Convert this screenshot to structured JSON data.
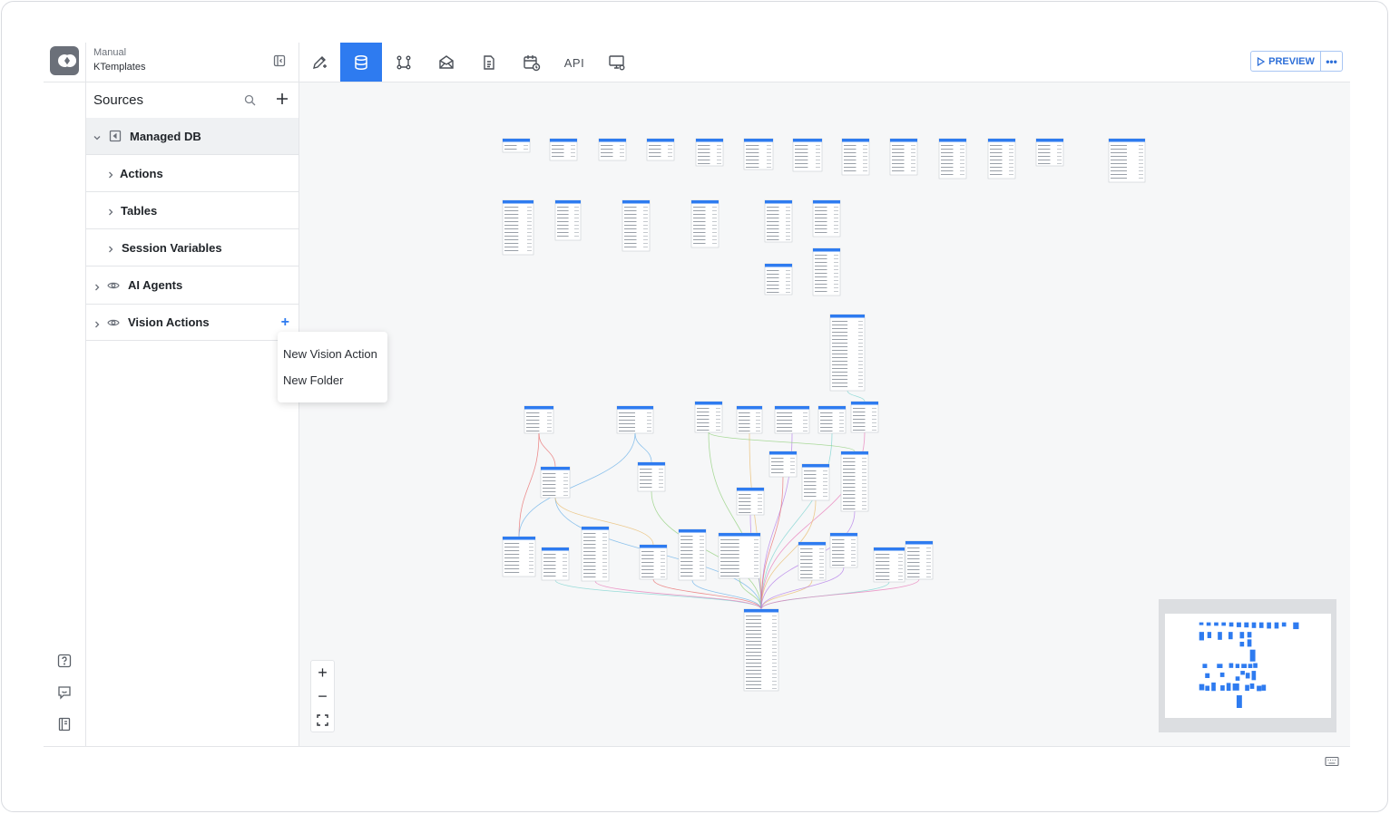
{
  "app": {
    "type_label": "Manual",
    "name": "KTemplates"
  },
  "toolbar": {
    "tabs": [
      {
        "icon": "pencil-plus-icon",
        "active": false
      },
      {
        "icon": "database-icon",
        "active": true
      },
      {
        "icon": "workflow-icon",
        "active": false
      },
      {
        "icon": "mail-icon",
        "active": false
      },
      {
        "icon": "document-icon",
        "active": false
      },
      {
        "icon": "calendar-clock-icon",
        "active": false
      },
      {
        "label": "API",
        "active": false
      },
      {
        "icon": "monitor-settings-icon",
        "active": false
      }
    ],
    "preview_label": "PREVIEW",
    "more_label": "•••",
    "accent_color": "#2e7bf0"
  },
  "sidebar": {
    "header": "Sources",
    "items": [
      {
        "label": "Managed DB",
        "level": 0,
        "expanded": true,
        "icon": "database-box-icon"
      },
      {
        "label": "Actions",
        "level": 1
      },
      {
        "label": "Tables",
        "level": 1
      },
      {
        "label": "Session Variables",
        "level": 1
      },
      {
        "label": "AI Agents",
        "level": 0,
        "icon": "eye-icon"
      },
      {
        "label": "Vision Actions",
        "level": 0,
        "icon": "eye-icon"
      }
    ],
    "add_label": "+"
  },
  "context_menu": {
    "items": [
      "New Vision Action",
      "New Folder"
    ]
  },
  "zoom": {
    "in_label": "+",
    "out_label": "−"
  }
}
